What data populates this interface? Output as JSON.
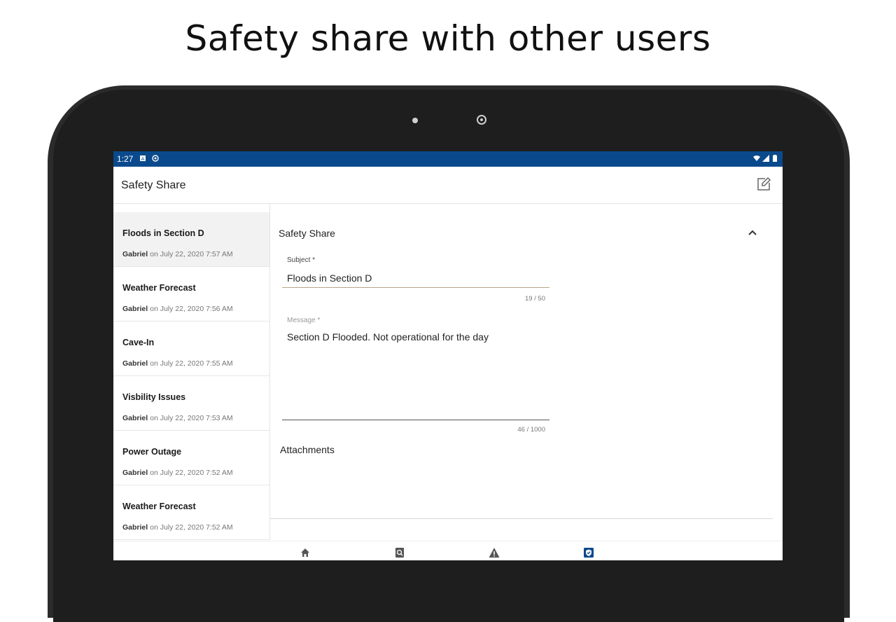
{
  "headline": "Safety share with other users",
  "status_bar": {
    "time": "1:27"
  },
  "app_bar": {
    "title": "Safety Share",
    "compose_icon": "compose-icon"
  },
  "list": {
    "items": [
      {
        "title": "Floods in Section D",
        "author": "Gabriel",
        "date": " on July 22, 2020 7:57 AM",
        "selected": true
      },
      {
        "title": "Weather Forecast",
        "author": "Gabriel",
        "date": " on July 22, 2020 7:56 AM"
      },
      {
        "title": "Cave-In",
        "author": "Gabriel",
        "date": " on July 22, 2020 7:55 AM"
      },
      {
        "title": "Visbility Issues",
        "author": "Gabriel",
        "date": " on July 22, 2020 7:53 AM"
      },
      {
        "title": "Power Outage",
        "author": "Gabriel",
        "date": " on July 22, 2020 7:52 AM"
      },
      {
        "title": "Weather Forecast",
        "author": "Gabriel",
        "date": " on July 22, 2020 7:52 AM"
      }
    ]
  },
  "detail": {
    "section_title": "Safety Share",
    "subject_label": "Subject *",
    "subject_value": "Floods in Section D",
    "subject_counter": "19 / 50",
    "message_label": "Message *",
    "message_value": "Section D Flooded. Not operational for the day",
    "message_counter": "46 / 1000",
    "attachments_label": "Attachments"
  },
  "bottom_nav": [
    "home-icon",
    "search-document-icon",
    "warning-icon",
    "shield-icon"
  ],
  "colors": {
    "status_bar": "#0a4a8c",
    "accent_underline": "#b9a58a",
    "selected_row": "#f2f2f2"
  }
}
